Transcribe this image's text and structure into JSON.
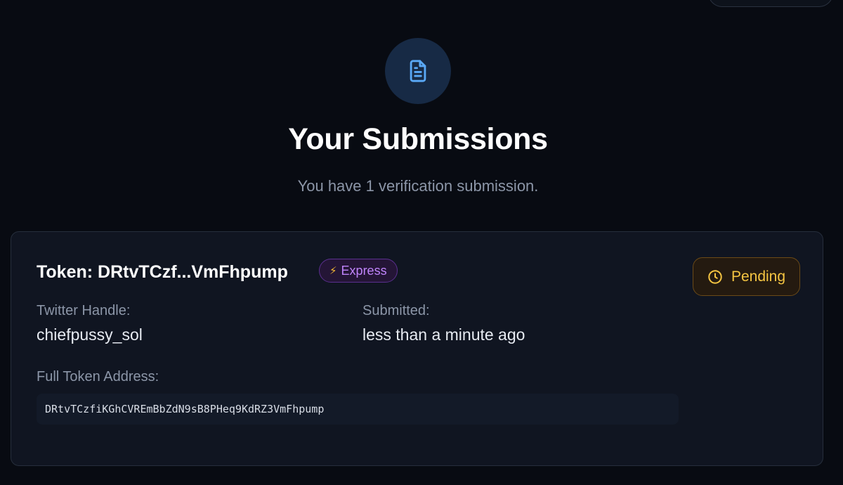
{
  "colors": {
    "background": "#080b12",
    "card": "#101521",
    "accent_blue": "#5aa9f7",
    "express_purple": "#c084fc",
    "pending_amber": "#f5c542"
  },
  "header": {
    "icon": "document-icon",
    "title": "Your Submissions",
    "subtitle": "You have 1 verification submission."
  },
  "submission": {
    "token_title": "Token: DRtvTCzf...VmFhpump",
    "tier_badge": {
      "icon": "lightning-icon",
      "label": "Express"
    },
    "status_badge": {
      "icon": "clock-icon",
      "label": "Pending"
    },
    "twitter_label": "Twitter Handle:",
    "twitter_value": "chiefpussy_sol",
    "submitted_label": "Submitted:",
    "submitted_value": "less than a minute ago",
    "address_label": "Full Token Address:",
    "address_value": "DRtvTCzfiKGhCVREmBbZdN9sB8PHeq9KdRZ3VmFhpump"
  }
}
